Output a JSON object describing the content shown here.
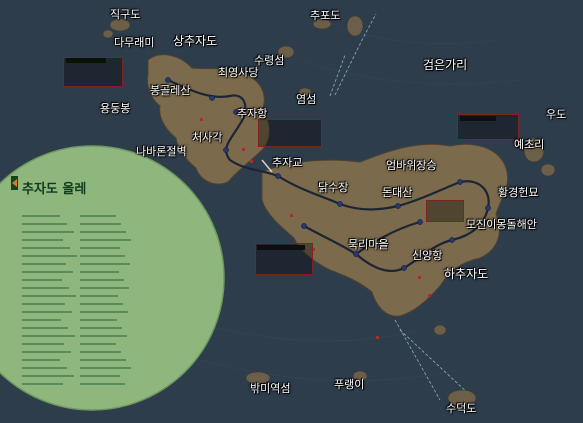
{
  "map": {
    "legend": {
      "title": "추자도 올레"
    },
    "places": [
      {
        "id": "jikgudo",
        "name": "직구도"
      },
      {
        "id": "chupodo",
        "name": "추포도"
      },
      {
        "id": "damurae",
        "name": "다무래미"
      },
      {
        "id": "sangchujado",
        "name": "상추자도"
      },
      {
        "id": "suryeongseom",
        "name": "수령섬"
      },
      {
        "id": "choeyoung",
        "name": "최영사당"
      },
      {
        "id": "bonggeullesan",
        "name": "봉골레산"
      },
      {
        "id": "yeomseom",
        "name": "염섬"
      },
      {
        "id": "geomeungari",
        "name": "검은가리"
      },
      {
        "id": "yongdeungbong",
        "name": "용둥봉"
      },
      {
        "id": "chujahang",
        "name": "추자항"
      },
      {
        "id": "udo",
        "name": "우도"
      },
      {
        "id": "cheosagak",
        "name": "처사각"
      },
      {
        "id": "nabareun",
        "name": "나바론절벽"
      },
      {
        "id": "yechori",
        "name": "예초리"
      },
      {
        "id": "eopbawi",
        "name": "엄바위장승"
      },
      {
        "id": "chujagyo",
        "name": "추자교"
      },
      {
        "id": "daksujang",
        "name": "닭수장"
      },
      {
        "id": "dondaesan",
        "name": "돈대산"
      },
      {
        "id": "hwanggyeong",
        "name": "황경헌묘"
      },
      {
        "id": "mojini",
        "name": "모진이몽돌해안"
      },
      {
        "id": "mukrimaeul",
        "name": "묵리마을"
      },
      {
        "id": "sinyanghang",
        "name": "신양항"
      },
      {
        "id": "hachujado",
        "name": "하추자도"
      },
      {
        "id": "bakmi",
        "name": "밖미역섬"
      },
      {
        "id": "puraengi",
        "name": "푸랭이"
      },
      {
        "id": "sudeokdo",
        "name": "수덕도"
      }
    ]
  }
}
